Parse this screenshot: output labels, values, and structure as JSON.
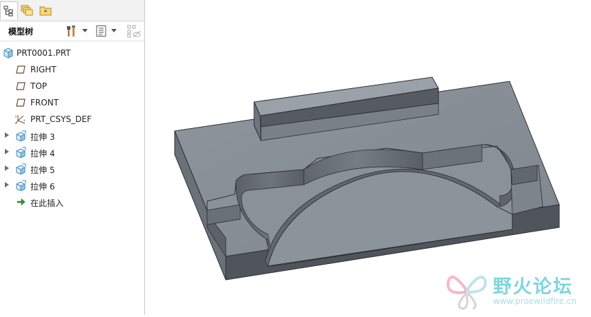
{
  "panel_tabs": [
    {
      "name": "model-tree-tab",
      "icon": "tree-structure-icon",
      "active": true
    },
    {
      "name": "layers-tab",
      "icon": "layers-icon",
      "active": false
    },
    {
      "name": "favorites-tab",
      "icon": "star-folder-icon",
      "active": false
    }
  ],
  "toolbar": {
    "title": "模型树",
    "buttons": [
      "tools-hammer-icon",
      "dropdown-arrow",
      "settings-list-icon",
      "dropdown-arrow",
      "show-hide-filter-icon"
    ]
  },
  "tree": {
    "root": {
      "label": "PRT0001.PRT",
      "icon": "part-icon"
    },
    "items": [
      {
        "label": "RIGHT",
        "icon": "datum-plane-icon",
        "expandable": false
      },
      {
        "label": "TOP",
        "icon": "datum-plane-icon",
        "expandable": false
      },
      {
        "label": "FRONT",
        "icon": "datum-plane-icon",
        "expandable": false
      },
      {
        "label": "PRT_CSYS_DEF",
        "icon": "coordinate-system-icon",
        "expandable": false
      },
      {
        "label": "拉伸 3",
        "icon": "extrude-icon",
        "expandable": true
      },
      {
        "label": "拉伸 4",
        "icon": "extrude-icon",
        "expandable": true
      },
      {
        "label": "拉伸 5",
        "icon": "extrude-icon",
        "expandable": true
      },
      {
        "label": "拉伸 6",
        "icon": "extrude-icon",
        "expandable": true
      },
      {
        "label": "在此插入",
        "icon": "insert-here-arrow-icon",
        "expandable": false
      }
    ]
  },
  "viewport": {
    "model": "3d-extruded-plate",
    "colors": {
      "top": "#858c94",
      "side_dark": "#50555c",
      "side_mid": "#6a7077",
      "edge": "#2b2e33"
    }
  },
  "watermark": {
    "text": "野火论坛",
    "url": "www.proewildfire.cn"
  }
}
